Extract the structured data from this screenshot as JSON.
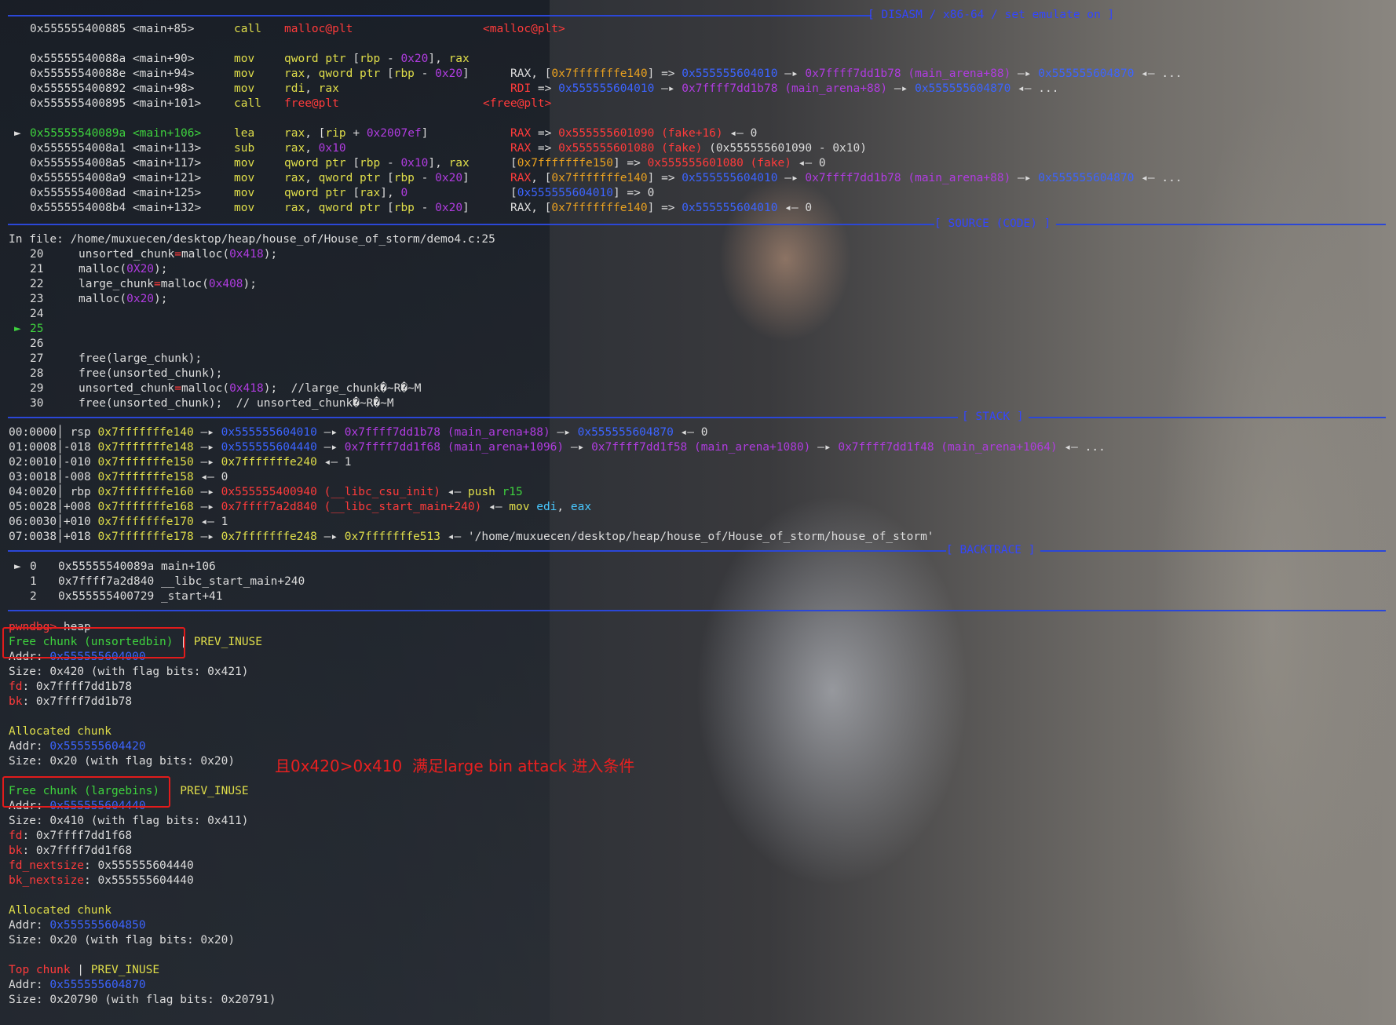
{
  "headers": {
    "disasm": "[ DISASM / x86-64 / set emulate on ]",
    "source": "[ SOURCE (CODE) ]",
    "stack": "[ STACK ]",
    "backtrace": "[ BACKTRACE ]"
  },
  "disasm": [
    {
      "marker": "",
      "addr": "0x555555400885 <main+85>",
      "mnem": "call",
      "ops": [
        [
          "r",
          "malloc@plt"
        ]
      ],
      "comment": [
        [
          "r",
          "<malloc@plt>"
        ]
      ]
    },
    {
      "blank": true
    },
    {
      "marker": "",
      "addr": "0x55555540088a <main+90>",
      "mnem": "mov",
      "ops": [
        [
          "y",
          "qword ptr "
        ],
        [
          "w",
          "["
        ],
        [
          "y",
          "rbp"
        ],
        [
          "w",
          " - "
        ],
        [
          "p",
          "0x20"
        ],
        [
          "w",
          "], "
        ],
        [
          "y",
          "rax"
        ]
      ],
      "comment": []
    },
    {
      "marker": "",
      "addr": "0x55555540088e <main+94>",
      "mnem": "mov",
      "ops": [
        [
          "y",
          "rax"
        ],
        [
          "w",
          ", "
        ],
        [
          "y",
          "qword ptr "
        ],
        [
          "w",
          "["
        ],
        [
          "y",
          "rbp"
        ],
        [
          "w",
          " - "
        ],
        [
          "p",
          "0x20"
        ],
        [
          "w",
          "]"
        ]
      ],
      "comment": [
        [
          "w",
          "RAX, ["
        ],
        [
          "o",
          "0x7fffffffe140"
        ],
        [
          "w",
          "] => "
        ],
        [
          "b",
          "0x555555604010"
        ],
        [
          "w",
          " —▸ "
        ],
        [
          "p",
          "0x7ffff7dd1b78"
        ],
        [
          "p",
          " (main_arena+88)"
        ],
        [
          "w",
          " —▸ "
        ],
        [
          "b",
          "0x555555604870"
        ],
        [
          "w",
          " ◂— ..."
        ]
      ]
    },
    {
      "marker": "",
      "addr": "0x555555400892 <main+98>",
      "mnem": "mov",
      "ops": [
        [
          "y",
          "rdi"
        ],
        [
          "w",
          ", "
        ],
        [
          "y",
          "rax"
        ]
      ],
      "comment": [
        [
          "r",
          "RDI"
        ],
        [
          "w",
          " => "
        ],
        [
          "b",
          "0x555555604010"
        ],
        [
          "w",
          " —▸ "
        ],
        [
          "p",
          "0x7ffff7dd1b78"
        ],
        [
          "p",
          " (main_arena+88)"
        ],
        [
          "w",
          " —▸ "
        ],
        [
          "b",
          "0x555555604870"
        ],
        [
          "w",
          " ◂— ..."
        ]
      ]
    },
    {
      "marker": "",
      "addr": "0x555555400895 <main+101>",
      "mnem": "call",
      "ops": [
        [
          "r",
          "free@plt"
        ]
      ],
      "comment": [
        [
          "r",
          "<free@plt>"
        ]
      ]
    },
    {
      "blank": true
    },
    {
      "marker": "►",
      "addr": "0x55555540089a <main+106>",
      "cur": true,
      "mnem": "lea",
      "ops": [
        [
          "y",
          "rax"
        ],
        [
          "w",
          ", ["
        ],
        [
          "y",
          "rip"
        ],
        [
          "w",
          " + "
        ],
        [
          "p",
          "0x2007ef"
        ],
        [
          "w",
          "]"
        ]
      ],
      "comment": [
        [
          "r",
          "RAX"
        ],
        [
          "w",
          " => "
        ],
        [
          "r",
          "0x555555601090"
        ],
        [
          "r",
          " (fake+16)"
        ],
        [
          "w",
          " ◂— 0"
        ]
      ]
    },
    {
      "marker": "",
      "addr": "0x5555554008a1 <main+113>",
      "mnem": "sub",
      "ops": [
        [
          "y",
          "rax"
        ],
        [
          "w",
          ", "
        ],
        [
          "p",
          "0x10"
        ]
      ],
      "comment": [
        [
          "r",
          "RAX"
        ],
        [
          "w",
          " => "
        ],
        [
          "r",
          "0x555555601080"
        ],
        [
          "r",
          " (fake)"
        ],
        [
          "w",
          " (0x555555601090 - 0x10)"
        ]
      ]
    },
    {
      "marker": "",
      "addr": "0x5555554008a5 <main+117>",
      "mnem": "mov",
      "ops": [
        [
          "y",
          "qword ptr "
        ],
        [
          "w",
          "["
        ],
        [
          "y",
          "rbp"
        ],
        [
          "w",
          " - "
        ],
        [
          "p",
          "0x10"
        ],
        [
          "w",
          "], "
        ],
        [
          "y",
          "rax"
        ]
      ],
      "comment": [
        [
          "w",
          "["
        ],
        [
          "o",
          "0x7fffffffe150"
        ],
        [
          "w",
          "] => "
        ],
        [
          "r",
          "0x555555601080"
        ],
        [
          "r",
          " (fake)"
        ],
        [
          "w",
          " ◂— 0"
        ]
      ]
    },
    {
      "marker": "",
      "addr": "0x5555554008a9 <main+121>",
      "mnem": "mov",
      "ops": [
        [
          "y",
          "rax"
        ],
        [
          "w",
          ", "
        ],
        [
          "y",
          "qword ptr "
        ],
        [
          "w",
          "["
        ],
        [
          "y",
          "rbp"
        ],
        [
          "w",
          " - "
        ],
        [
          "p",
          "0x20"
        ],
        [
          "w",
          "]"
        ]
      ],
      "comment": [
        [
          "r",
          "RAX"
        ],
        [
          "w",
          ", ["
        ],
        [
          "o",
          "0x7fffffffe140"
        ],
        [
          "w",
          "] => "
        ],
        [
          "b",
          "0x555555604010"
        ],
        [
          "w",
          " —▸ "
        ],
        [
          "p",
          "0x7ffff7dd1b78"
        ],
        [
          "p",
          " (main_arena+88)"
        ],
        [
          "w",
          " —▸ "
        ],
        [
          "b",
          "0x555555604870"
        ],
        [
          "w",
          " ◂— ..."
        ]
      ]
    },
    {
      "marker": "",
      "addr": "0x5555554008ad <main+125>",
      "mnem": "mov",
      "ops": [
        [
          "y",
          "qword ptr "
        ],
        [
          "w",
          "["
        ],
        [
          "y",
          "rax"
        ],
        [
          "w",
          "], "
        ],
        [
          "p",
          "0"
        ]
      ],
      "comment": [
        [
          "w",
          "["
        ],
        [
          "b",
          "0x555555604010"
        ],
        [
          "w",
          "] => 0"
        ]
      ]
    },
    {
      "marker": "",
      "addr": "0x5555554008b4 <main+132>",
      "mnem": "mov",
      "ops": [
        [
          "y",
          "rax"
        ],
        [
          "w",
          ", "
        ],
        [
          "y",
          "qword ptr "
        ],
        [
          "w",
          "["
        ],
        [
          "y",
          "rbp"
        ],
        [
          "w",
          " - "
        ],
        [
          "p",
          "0x20"
        ],
        [
          "w",
          "]"
        ]
      ],
      "comment": [
        [
          "w",
          "RAX, ["
        ],
        [
          "o",
          "0x7fffffffe140"
        ],
        [
          "w",
          "] => "
        ],
        [
          "b",
          "0x555555604010"
        ],
        [
          "w",
          " ◂— 0"
        ]
      ]
    }
  ],
  "source": {
    "file_line": "In file: /home/muxuecen/desktop/heap/house_of/House_of_storm/demo4.c:25",
    "lines": [
      {
        "n": "20",
        "cur": false,
        "code": [
          [
            "w",
            "unsorted_chunk"
          ],
          [
            "r",
            "="
          ],
          [
            "w",
            "malloc("
          ],
          [
            "p",
            "0x418"
          ],
          [
            "w",
            ");"
          ]
        ]
      },
      {
        "n": "21",
        "cur": false,
        "code": [
          [
            "w",
            "malloc("
          ],
          [
            "p",
            "0X20"
          ],
          [
            "w",
            ");"
          ]
        ]
      },
      {
        "n": "22",
        "cur": false,
        "code": [
          [
            "w",
            "large_chunk"
          ],
          [
            "r",
            "="
          ],
          [
            "w",
            "malloc("
          ],
          [
            "p",
            "0x408"
          ],
          [
            "w",
            ");"
          ]
        ]
      },
      {
        "n": "23",
        "cur": false,
        "code": [
          [
            "w",
            "malloc("
          ],
          [
            "p",
            "0x20"
          ],
          [
            "w",
            ");"
          ]
        ]
      },
      {
        "n": "24",
        "cur": false,
        "code": []
      },
      {
        "n": "25",
        "cur": true,
        "code": []
      },
      {
        "n": "26",
        "cur": false,
        "code": []
      },
      {
        "n": "27",
        "cur": false,
        "code": [
          [
            "w",
            "free(large_chunk);"
          ]
        ]
      },
      {
        "n": "28",
        "cur": false,
        "code": [
          [
            "w",
            "free(unsorted_chunk);"
          ]
        ]
      },
      {
        "n": "29",
        "cur": false,
        "code": [
          [
            "w",
            "unsorted_chunk"
          ],
          [
            "r",
            "="
          ],
          [
            "w",
            "malloc("
          ],
          [
            "p",
            "0x418"
          ],
          [
            "w",
            ");  "
          ],
          [
            "w",
            "//large_chunk�~R�~M"
          ]
        ]
      },
      {
        "n": "30",
        "cur": false,
        "code": [
          [
            "w",
            "free(unsorted_chunk);  "
          ],
          [
            "w",
            "// unsorted_chunk�~R�~M"
          ]
        ]
      }
    ]
  },
  "stack": [
    [
      [
        "w",
        "00:0000│ "
      ],
      [
        "w",
        "rsp "
      ],
      [
        "y",
        "0x7fffffffe140"
      ],
      [
        "w",
        " —▸ "
      ],
      [
        "b",
        "0x555555604010"
      ],
      [
        "w",
        " —▸ "
      ],
      [
        "p",
        "0x7ffff7dd1b78"
      ],
      [
        "p",
        " (main_arena+88)"
      ],
      [
        "w",
        " —▸ "
      ],
      [
        "b",
        "0x555555604870"
      ],
      [
        "w",
        " ◂— 0"
      ]
    ],
    [
      [
        "w",
        "01:0008│-018 "
      ],
      [
        "y",
        "0x7fffffffe148"
      ],
      [
        "w",
        " —▸ "
      ],
      [
        "b",
        "0x555555604440"
      ],
      [
        "w",
        " —▸ "
      ],
      [
        "p",
        "0x7ffff7dd1f68"
      ],
      [
        "p",
        " (main_arena+1096)"
      ],
      [
        "w",
        " —▸ "
      ],
      [
        "p",
        "0x7ffff7dd1f58"
      ],
      [
        "p",
        " (main_arena+1080)"
      ],
      [
        "w",
        " —▸ "
      ],
      [
        "p",
        "0x7ffff7dd1f48"
      ],
      [
        "p",
        " (main_arena+1064)"
      ],
      [
        "w",
        " ◂— ..."
      ]
    ],
    [
      [
        "w",
        "02:0010│-010 "
      ],
      [
        "y",
        "0x7fffffffe150"
      ],
      [
        "w",
        " —▸ "
      ],
      [
        "y",
        "0x7fffffffe240"
      ],
      [
        "w",
        " ◂— 1"
      ]
    ],
    [
      [
        "w",
        "03:0018│-008 "
      ],
      [
        "y",
        "0x7fffffffe158"
      ],
      [
        "w",
        " ◂— 0"
      ]
    ],
    [
      [
        "w",
        "04:0020│ "
      ],
      [
        "w",
        "rbp "
      ],
      [
        "y",
        "0x7fffffffe160"
      ],
      [
        "w",
        " —▸ "
      ],
      [
        "r",
        "0x555555400940"
      ],
      [
        "r",
        " (__libc_csu_init)"
      ],
      [
        "w",
        " ◂— "
      ],
      [
        "y",
        "push "
      ],
      [
        "g",
        "r15"
      ]
    ],
    [
      [
        "w",
        "05:0028│+008 "
      ],
      [
        "y",
        "0x7fffffffe168"
      ],
      [
        "w",
        " —▸ "
      ],
      [
        "r",
        "0x7ffff7a2d840"
      ],
      [
        "r",
        " (__libc_start_main+240)"
      ],
      [
        "w",
        " ◂— "
      ],
      [
        "y",
        "mov "
      ],
      [
        "c",
        "edi"
      ],
      [
        "w",
        ", "
      ],
      [
        "c",
        "eax"
      ]
    ],
    [
      [
        "w",
        "06:0030│+010 "
      ],
      [
        "y",
        "0x7fffffffe170"
      ],
      [
        "w",
        " ◂— 1"
      ]
    ],
    [
      [
        "w",
        "07:0038│+018 "
      ],
      [
        "y",
        "0x7fffffffe178"
      ],
      [
        "w",
        " —▸ "
      ],
      [
        "y",
        "0x7fffffffe248"
      ],
      [
        "w",
        " —▸ "
      ],
      [
        "y",
        "0x7fffffffe513"
      ],
      [
        "w",
        " ◂— '/home/muxuecen/desktop/heap/house_of/House_of_storm/house_of_storm'"
      ]
    ]
  ],
  "backtrace": [
    {
      "marker": "►",
      "idx": "0",
      "text": "0x55555540089a main+106"
    },
    {
      "marker": "",
      "idx": "1",
      "text": "0x7ffff7a2d840 __libc_start_main+240"
    },
    {
      "marker": "",
      "idx": "2",
      "text": "0x555555400729 _start+41"
    }
  ],
  "heap": {
    "prompt": "pwndbg>",
    "command": " heap",
    "lines": [
      [
        [
          "g",
          "Free chunk (unsortedbin)"
        ],
        [
          "w",
          " | "
        ],
        [
          "y",
          "PREV_INUSE"
        ]
      ],
      [
        [
          "w",
          "Addr: "
        ],
        [
          "b",
          "0x555555604000"
        ]
      ],
      [
        [
          "w",
          "Size: 0x420 (with flag bits: 0x421)"
        ]
      ],
      [
        [
          "r",
          "fd"
        ],
        [
          "w",
          ": 0x7ffff7dd1b78"
        ]
      ],
      [
        [
          "r",
          "bk"
        ],
        [
          "w",
          ": 0x7ffff7dd1b78"
        ]
      ],
      [],
      [
        [
          "y",
          "Allocated chunk"
        ]
      ],
      [
        [
          "w",
          "Addr: "
        ],
        [
          "b",
          "0x555555604420"
        ]
      ],
      [
        [
          "w",
          "Size: 0x20 (with flag bits: 0x20)"
        ]
      ],
      [],
      [
        [
          "g",
          "Free chunk (largebins)"
        ],
        [
          "w",
          " | "
        ],
        [
          "y",
          "PREV_INUSE"
        ]
      ],
      [
        [
          "w",
          "Addr: "
        ],
        [
          "b",
          "0x555555604440"
        ]
      ],
      [
        [
          "w",
          "Size: 0x410 (with flag bits: 0x411)"
        ]
      ],
      [
        [
          "r",
          "fd"
        ],
        [
          "w",
          ": 0x7ffff7dd1f68"
        ]
      ],
      [
        [
          "r",
          "bk"
        ],
        [
          "w",
          ": 0x7ffff7dd1f68"
        ]
      ],
      [
        [
          "r",
          "fd_nextsize"
        ],
        [
          "w",
          ": 0x555555604440"
        ]
      ],
      [
        [
          "r",
          "bk_nextsize"
        ],
        [
          "w",
          ": 0x555555604440"
        ]
      ],
      [],
      [
        [
          "y",
          "Allocated chunk"
        ]
      ],
      [
        [
          "w",
          "Addr: "
        ],
        [
          "b",
          "0x555555604850"
        ]
      ],
      [
        [
          "w",
          "Size: 0x20 (with flag bits: 0x20)"
        ]
      ],
      [],
      [
        [
          "r",
          "Top chunk"
        ],
        [
          "w",
          " | "
        ],
        [
          "y",
          "PREV_INUSE"
        ]
      ],
      [
        [
          "w",
          "Addr: "
        ],
        [
          "b",
          "0x555555604870"
        ]
      ],
      [
        [
          "w",
          "Size: 0x20790 (with flag bits: 0x20791)"
        ]
      ]
    ]
  },
  "annotation": "且0x420>0x410  满足large bin attack 进入条件"
}
